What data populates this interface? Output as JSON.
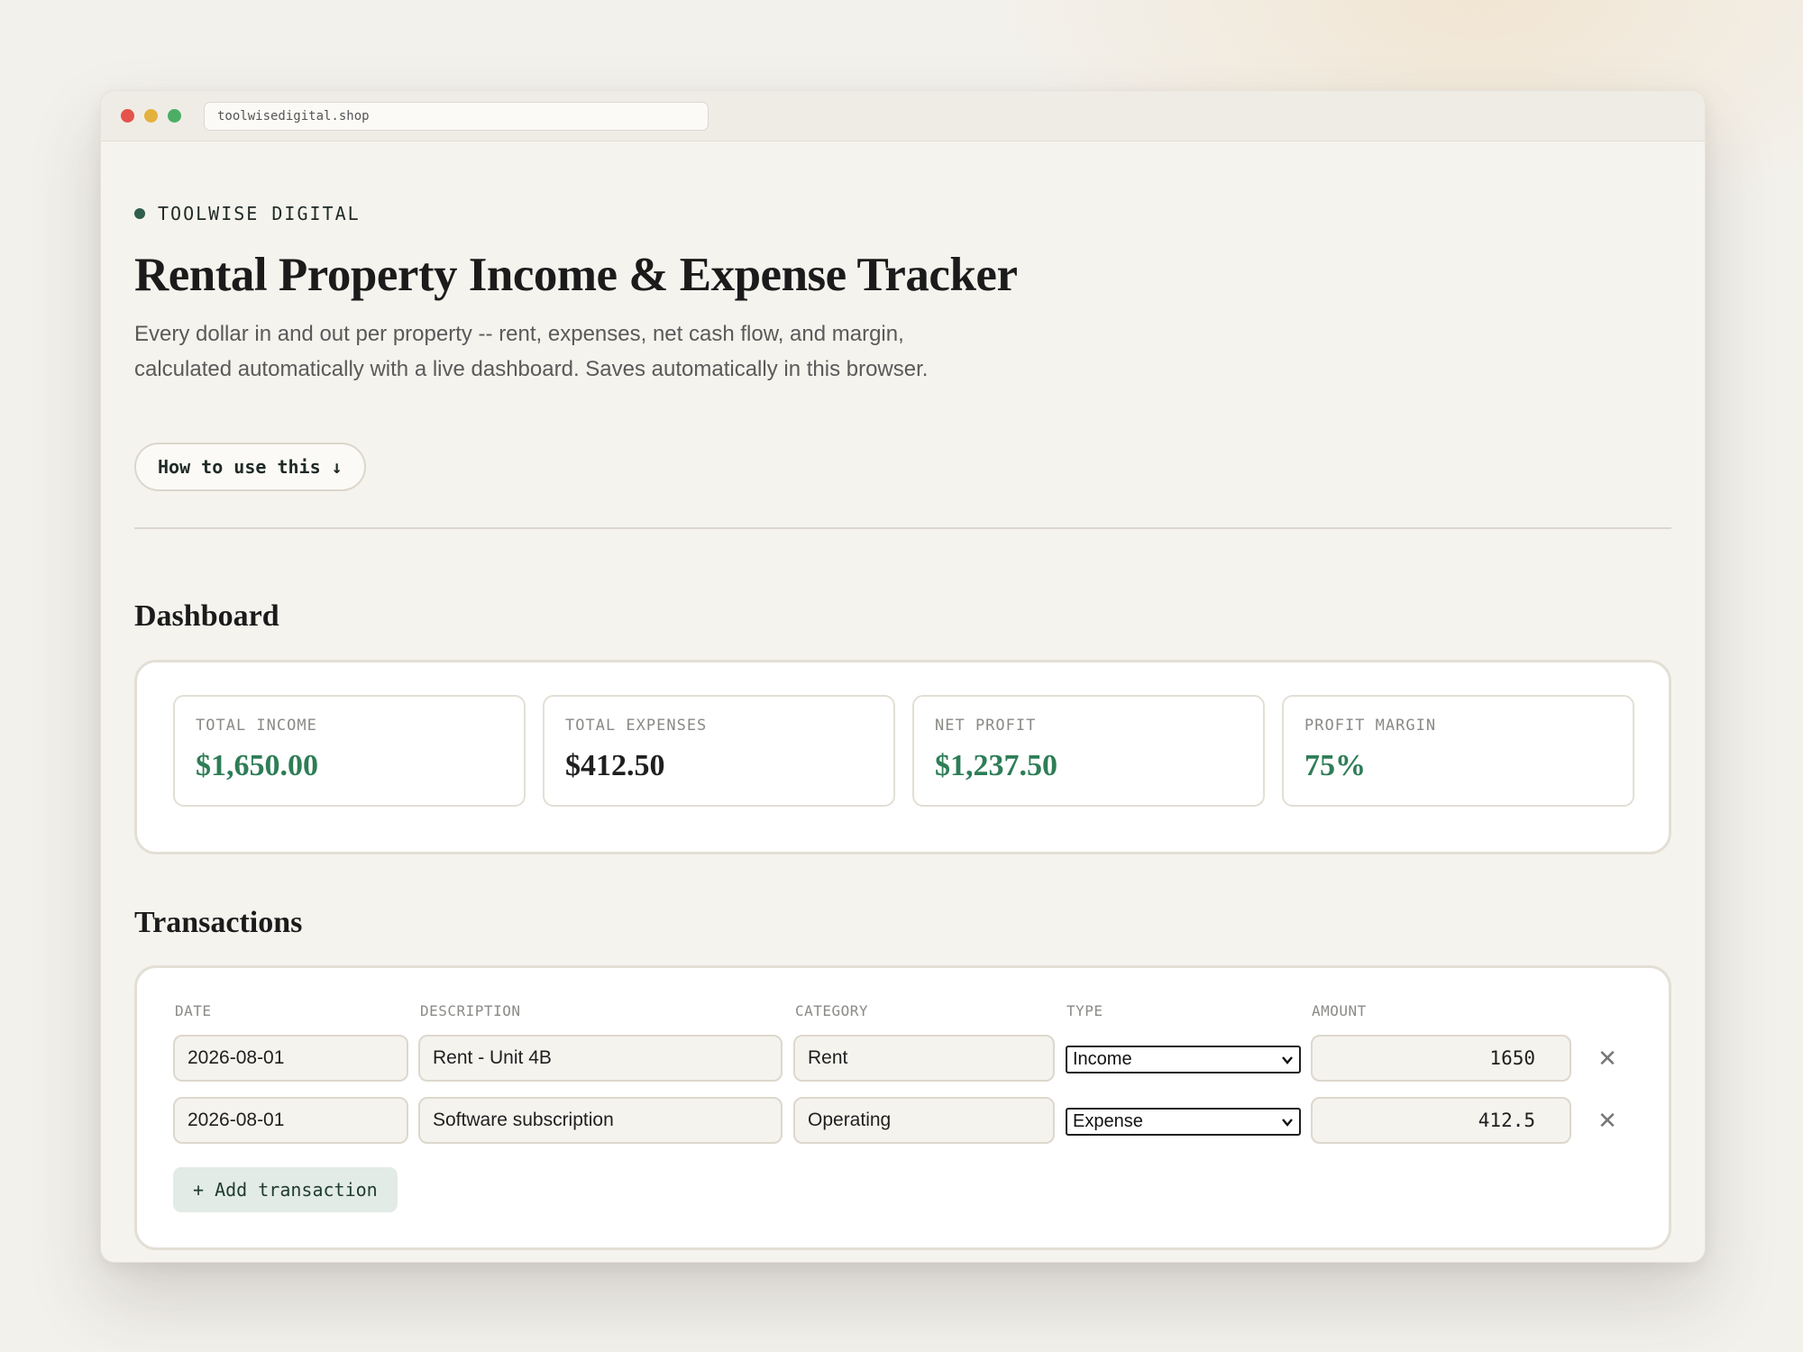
{
  "browser": {
    "url": "toolwisedigital.shop"
  },
  "brand": {
    "name": "TOOLWISE DIGITAL"
  },
  "header": {
    "title": "Rental Property Income & Expense Tracker",
    "subtitle": "Every dollar in and out per property -- rent, expenses, net cash flow, and margin, calculated automatically with a live dashboard. Saves automatically in this browser.",
    "howto_label": "How to use this ↓"
  },
  "dashboard": {
    "heading": "Dashboard",
    "stats": [
      {
        "label": "TOTAL INCOME",
        "value": "$1,650.00",
        "color": "#2e7d57"
      },
      {
        "label": "TOTAL EXPENSES",
        "value": "$412.50",
        "color": "#1f1f1f"
      },
      {
        "label": "NET PROFIT",
        "value": "$1,237.50",
        "color": "#2e7d57"
      },
      {
        "label": "PROFIT MARGIN",
        "value": "75%",
        "color": "#2e7d57"
      }
    ]
  },
  "transactions": {
    "heading": "Transactions",
    "columns": [
      "DATE",
      "DESCRIPTION",
      "CATEGORY",
      "TYPE",
      "AMOUNT"
    ],
    "rows": [
      {
        "date": "2026-08-01",
        "description": "Rent - Unit 4B",
        "category": "Rent",
        "type": "Income",
        "amount": "1650"
      },
      {
        "date": "2026-08-01",
        "description": "Software subscription",
        "category": "Operating",
        "type": "Expense",
        "amount": "412.5"
      }
    ],
    "remove_symbol": "✕",
    "add_label": "+ Add transaction"
  }
}
